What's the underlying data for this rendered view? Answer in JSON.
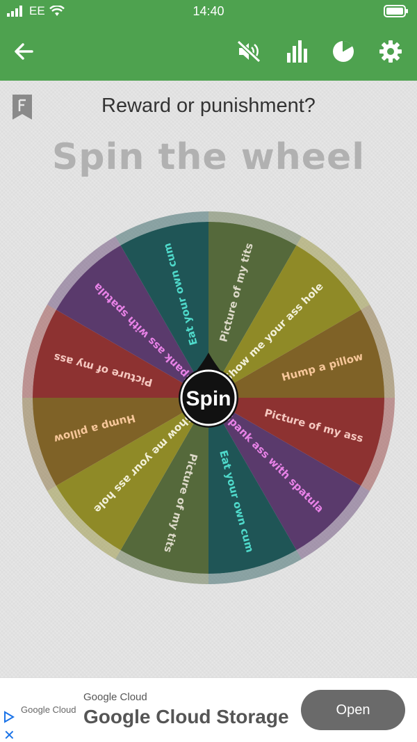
{
  "status_bar": {
    "carrier": "EE",
    "time": "14:40"
  },
  "toolbar": {
    "back_icon": "back-arrow-icon",
    "mute_icon": "sound-muted-icon",
    "stats_icon": "bar-chart-icon",
    "pie_icon": "pie-chart-icon",
    "settings_icon": "gear-icon"
  },
  "header": {
    "question": "Reward or punishment?",
    "title": "Spin the wheel"
  },
  "wheel": {
    "spin_label": "Spin",
    "segments": [
      {
        "label": "Picture of my tits",
        "color": "#55693b",
        "text_color": "#dcd9c8"
      },
      {
        "label": "Show me your ass hole",
        "color": "#8f8a27",
        "text_color": "#f2f0d8"
      },
      {
        "label": "Hump a pillow",
        "color": "#7f6227",
        "text_color": "#f7c79a"
      },
      {
        "label": "Picture of my ass",
        "color": "#8d3231",
        "text_color": "#f5c8c0"
      },
      {
        "label": "Spank ass with spatula",
        "color": "#5a3a6c",
        "text_color": "#e882e7"
      },
      {
        "label": "Eat your own cum",
        "color": "#1f5556",
        "text_color": "#4fdacb"
      },
      {
        "label": "Picture of my tits",
        "color": "#55693b",
        "text_color": "#dcd9c8"
      },
      {
        "label": "Show me your ass hole",
        "color": "#8f8a27",
        "text_color": "#f2f0d8"
      },
      {
        "label": "Hump a pillow",
        "color": "#7f6227",
        "text_color": "#f7c79a"
      },
      {
        "label": "Picture of my ass",
        "color": "#8d3231",
        "text_color": "#f5c8c0"
      },
      {
        "label": "Spank ass with spatula",
        "color": "#5a3a6c",
        "text_color": "#e882e7"
      },
      {
        "label": "Eat your own cum",
        "color": "#1f5556",
        "text_color": "#4fdacb"
      }
    ]
  },
  "ad": {
    "logo_text": "Google Cloud",
    "advertiser": "Google Cloud",
    "headline": "Google Cloud Storage",
    "cta": "Open"
  },
  "colors": {
    "app_bar": "#4ea24f",
    "background": "#e6e6e6"
  }
}
